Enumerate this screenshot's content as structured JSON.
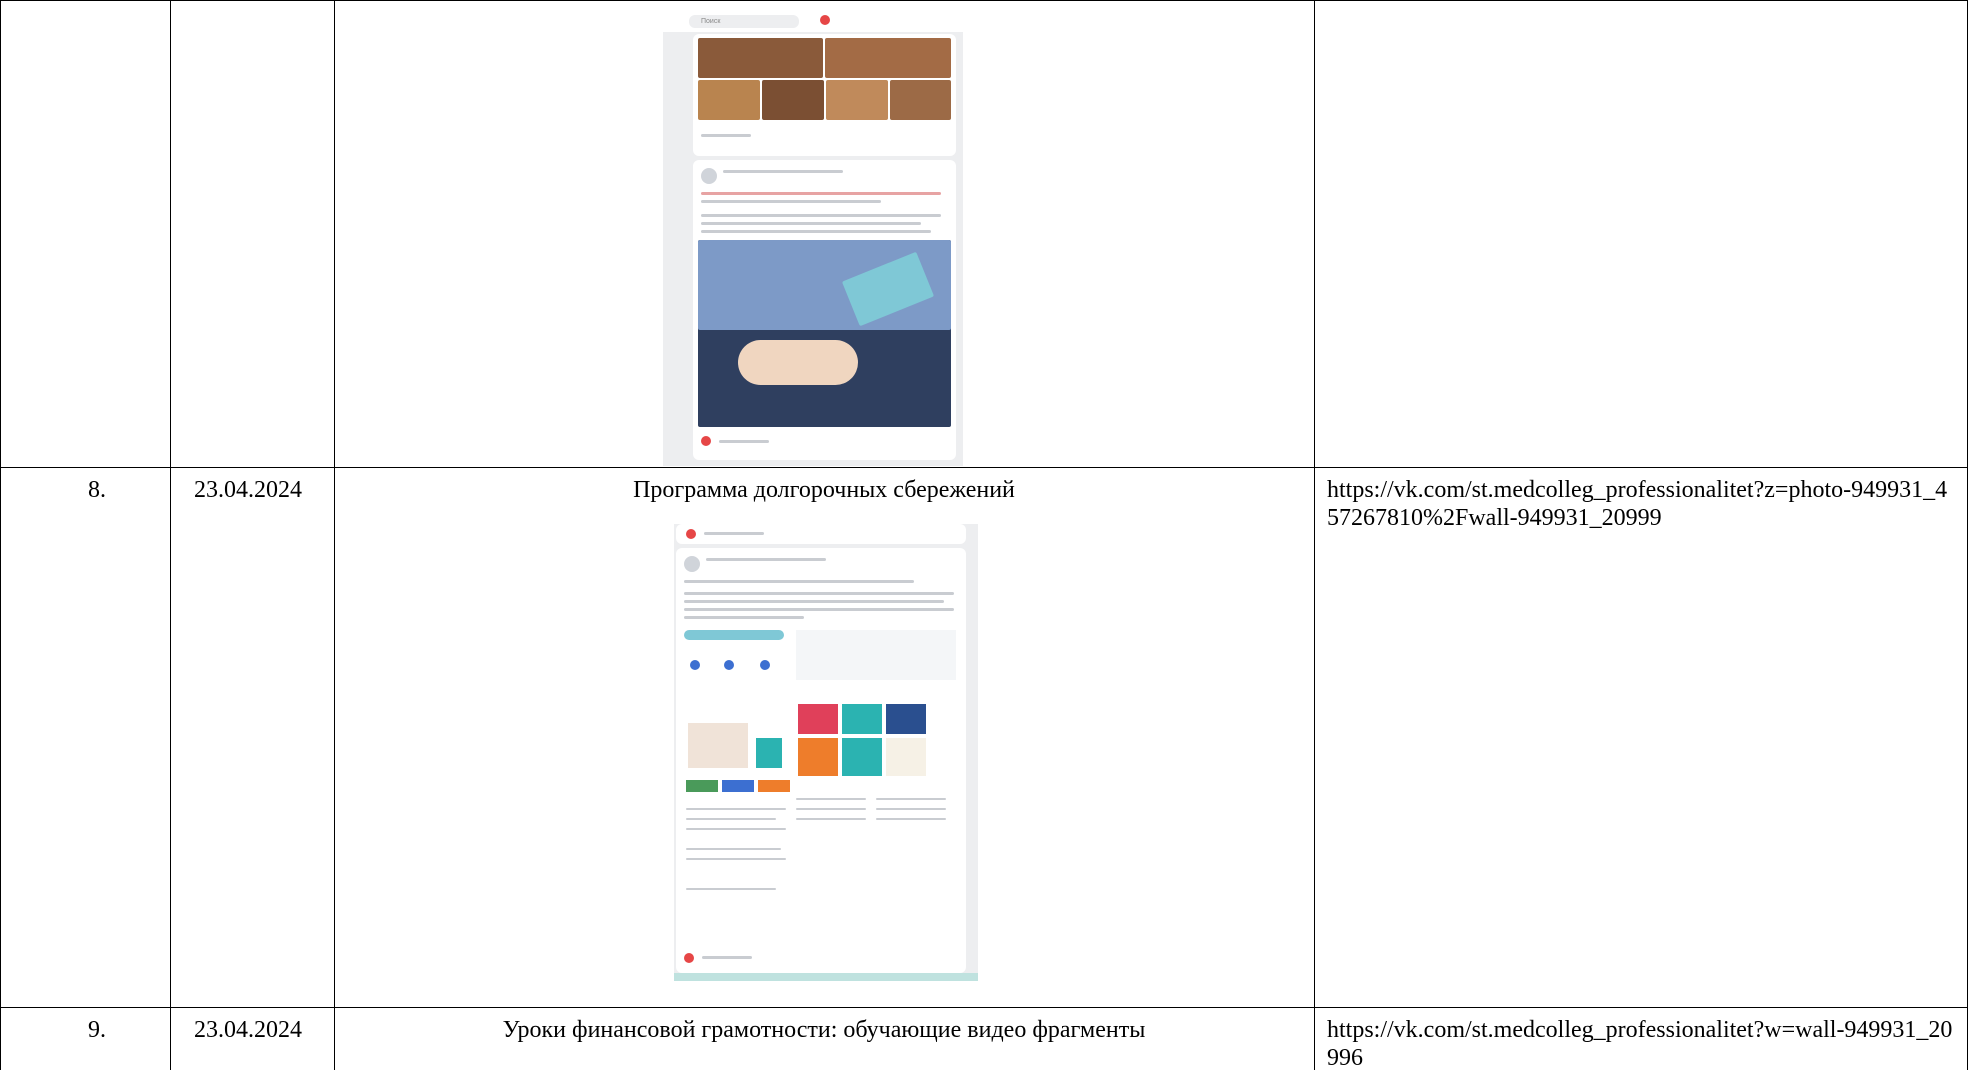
{
  "rows": [
    {
      "number": "8.",
      "date": "23.04.2024",
      "title": "Программа долгорочных сбережений",
      "link": "https://vk.com/st.medcolleg_professionalitet?z=photo-949931_457267810%2Fwall-949931_20999"
    },
    {
      "number": "9.",
      "date": "23.04.2024",
      "title": "Уроки финансовой грамотности: обучающие видео фрагменты",
      "link": "https://vk.com/st.medcolleg_professionalitet?w=wall-949931_20996"
    }
  ],
  "screenshot_1": {
    "search_placeholder": "Поиск"
  },
  "colors": {
    "border": "#000000",
    "vk_bg": "#edeef0",
    "card": "#ffffff",
    "card_blue": "#7fc8d6",
    "tile_red": "#e0405a",
    "tile_teal": "#2bb3b1",
    "tile_navy": "#2a4f8f",
    "tile_orange": "#ee7d2b",
    "tile_green": "#4a9a5a",
    "tile_blue": "#3c6fd1"
  }
}
